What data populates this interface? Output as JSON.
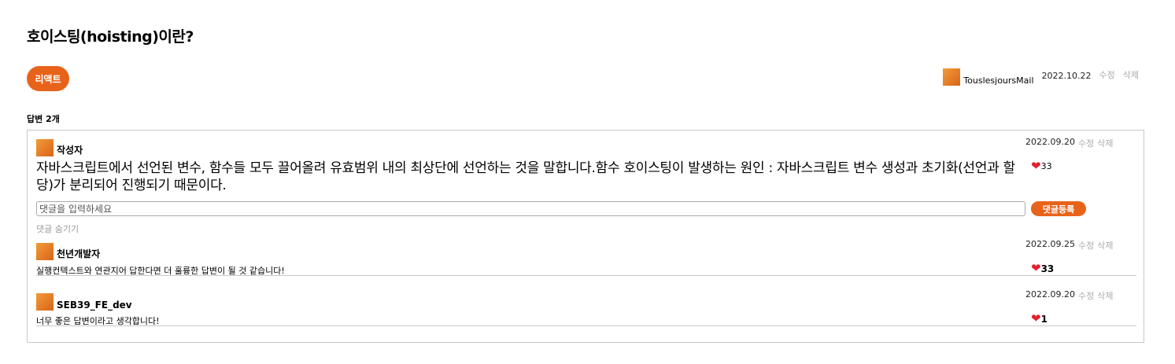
{
  "question": {
    "title": "호이스팅(hoisting)이란?",
    "tag": "리액트",
    "author": "TouslesjoursMail",
    "date": "2022.10.22",
    "edit_label": "수정",
    "delete_label": "삭제"
  },
  "answers_header": "답변 2개",
  "answer": {
    "author": "작성자",
    "date": "2022.09.20",
    "edit_label": "수정",
    "delete_label": "삭제",
    "body": "자바스크립트에서 선언된 변수, 함수들 모두 끌어올려 유효범위 내의 최상단에 선언하는 것을 말합니다.함수 호이스팅이 발생하는 원인 : 자바스크립트 변수 생성과 초기화(선언과 할당)가 분리되어 진행되기 때문이다.",
    "likes": "33",
    "comment_placeholder": "댓글을 입력하세요",
    "comment_submit": "댓글등록",
    "hide_comments": "댓글 숨기기"
  },
  "comments": [
    {
      "author": "천년개발자",
      "date": "2022.09.25",
      "edit_label": "수정",
      "delete_label": "삭제",
      "text": "실행컨텍스트와 연관지어 답한다면 더 훌륭한 답변이 될 것 같습니다!",
      "likes": "33"
    },
    {
      "author": "SEB39_FE_dev",
      "date": "2022.09.20",
      "edit_label": "수정",
      "delete_label": "삭제",
      "text": "너무 좋은 답변이라고 생각합니다!",
      "likes": "1"
    }
  ],
  "colors": {
    "accent": "#e8631a",
    "heart": "#e0232e",
    "border": "#c8c8c8"
  }
}
